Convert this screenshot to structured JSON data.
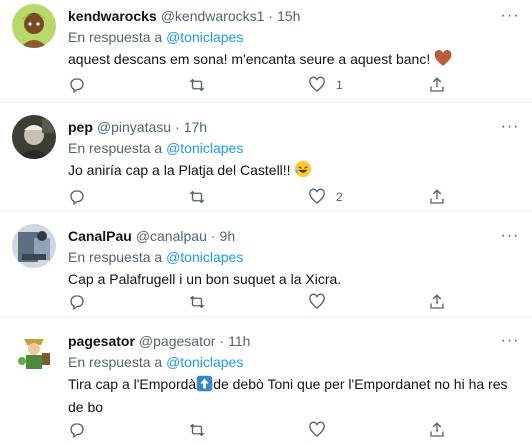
{
  "replies": [
    {
      "name": "kendwarocks",
      "handle": "@kendwarocks1",
      "time": "15h",
      "reply_prefix": "En respuesta a",
      "reply_to": "@toniclapes",
      "text": "aquest descans em sona! m'encanta seure a aquest banc!",
      "emoji": "brown-heart",
      "likes": "1"
    },
    {
      "name": "pep",
      "handle": "@pinyatasu",
      "time": "17h",
      "reply_prefix": "En respuesta a",
      "reply_to": "@toniclapes",
      "text": "Jo aniría cap a la Platja del Castell!!",
      "emoji": "rolling-laughing-face",
      "likes": "2"
    },
    {
      "name": "CanalPau",
      "handle": "@canalpau",
      "time": "9h",
      "reply_prefix": "En respuesta a",
      "reply_to": "@toniclapes",
      "text": "Cap a Palafrugell i un bon suquet a la Xicra.",
      "likes": ""
    },
    {
      "name": "pagesator",
      "handle": "@pagesator",
      "time": "11h",
      "reply_prefix": "En respuesta a",
      "reply_to": "@toniclapes",
      "text_before": "Tira cap a l'Empordà",
      "emoji": "up-arrow",
      "text_after": "de debò Toni que per l'Empordanet no hi ha res de bo",
      "likes": ""
    }
  ],
  "colors": {
    "accent": "#1d9bf0",
    "secondary": "#536471",
    "heart": "#a0522d"
  }
}
